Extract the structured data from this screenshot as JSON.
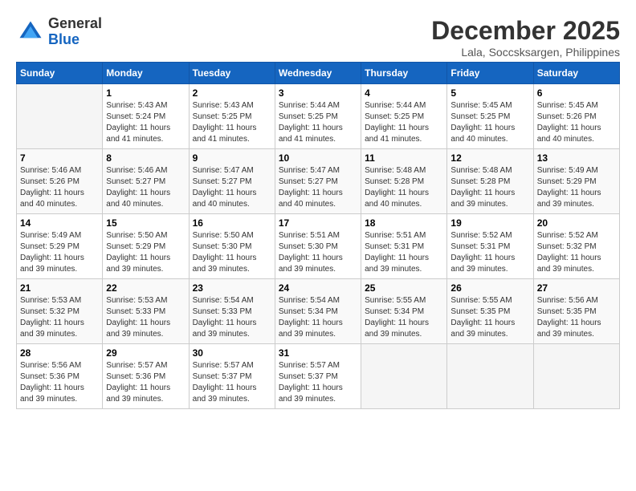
{
  "header": {
    "logo_general": "General",
    "logo_blue": "Blue",
    "month_title": "December 2025",
    "location": "Lala, Soccsksargen, Philippines"
  },
  "days_of_week": [
    "Sunday",
    "Monday",
    "Tuesday",
    "Wednesday",
    "Thursday",
    "Friday",
    "Saturday"
  ],
  "weeks": [
    [
      {
        "day": "",
        "sunrise": "",
        "sunset": "",
        "daylight": ""
      },
      {
        "day": "1",
        "sunrise": "Sunrise: 5:43 AM",
        "sunset": "Sunset: 5:24 PM",
        "daylight": "Daylight: 11 hours and 41 minutes."
      },
      {
        "day": "2",
        "sunrise": "Sunrise: 5:43 AM",
        "sunset": "Sunset: 5:25 PM",
        "daylight": "Daylight: 11 hours and 41 minutes."
      },
      {
        "day": "3",
        "sunrise": "Sunrise: 5:44 AM",
        "sunset": "Sunset: 5:25 PM",
        "daylight": "Daylight: 11 hours and 41 minutes."
      },
      {
        "day": "4",
        "sunrise": "Sunrise: 5:44 AM",
        "sunset": "Sunset: 5:25 PM",
        "daylight": "Daylight: 11 hours and 41 minutes."
      },
      {
        "day": "5",
        "sunrise": "Sunrise: 5:45 AM",
        "sunset": "Sunset: 5:25 PM",
        "daylight": "Daylight: 11 hours and 40 minutes."
      },
      {
        "day": "6",
        "sunrise": "Sunrise: 5:45 AM",
        "sunset": "Sunset: 5:26 PM",
        "daylight": "Daylight: 11 hours and 40 minutes."
      }
    ],
    [
      {
        "day": "7",
        "sunrise": "Sunrise: 5:46 AM",
        "sunset": "Sunset: 5:26 PM",
        "daylight": "Daylight: 11 hours and 40 minutes."
      },
      {
        "day": "8",
        "sunrise": "Sunrise: 5:46 AM",
        "sunset": "Sunset: 5:27 PM",
        "daylight": "Daylight: 11 hours and 40 minutes."
      },
      {
        "day": "9",
        "sunrise": "Sunrise: 5:47 AM",
        "sunset": "Sunset: 5:27 PM",
        "daylight": "Daylight: 11 hours and 40 minutes."
      },
      {
        "day": "10",
        "sunrise": "Sunrise: 5:47 AM",
        "sunset": "Sunset: 5:27 PM",
        "daylight": "Daylight: 11 hours and 40 minutes."
      },
      {
        "day": "11",
        "sunrise": "Sunrise: 5:48 AM",
        "sunset": "Sunset: 5:28 PM",
        "daylight": "Daylight: 11 hours and 40 minutes."
      },
      {
        "day": "12",
        "sunrise": "Sunrise: 5:48 AM",
        "sunset": "Sunset: 5:28 PM",
        "daylight": "Daylight: 11 hours and 39 minutes."
      },
      {
        "day": "13",
        "sunrise": "Sunrise: 5:49 AM",
        "sunset": "Sunset: 5:29 PM",
        "daylight": "Daylight: 11 hours and 39 minutes."
      }
    ],
    [
      {
        "day": "14",
        "sunrise": "Sunrise: 5:49 AM",
        "sunset": "Sunset: 5:29 PM",
        "daylight": "Daylight: 11 hours and 39 minutes."
      },
      {
        "day": "15",
        "sunrise": "Sunrise: 5:50 AM",
        "sunset": "Sunset: 5:29 PM",
        "daylight": "Daylight: 11 hours and 39 minutes."
      },
      {
        "day": "16",
        "sunrise": "Sunrise: 5:50 AM",
        "sunset": "Sunset: 5:30 PM",
        "daylight": "Daylight: 11 hours and 39 minutes."
      },
      {
        "day": "17",
        "sunrise": "Sunrise: 5:51 AM",
        "sunset": "Sunset: 5:30 PM",
        "daylight": "Daylight: 11 hours and 39 minutes."
      },
      {
        "day": "18",
        "sunrise": "Sunrise: 5:51 AM",
        "sunset": "Sunset: 5:31 PM",
        "daylight": "Daylight: 11 hours and 39 minutes."
      },
      {
        "day": "19",
        "sunrise": "Sunrise: 5:52 AM",
        "sunset": "Sunset: 5:31 PM",
        "daylight": "Daylight: 11 hours and 39 minutes."
      },
      {
        "day": "20",
        "sunrise": "Sunrise: 5:52 AM",
        "sunset": "Sunset: 5:32 PM",
        "daylight": "Daylight: 11 hours and 39 minutes."
      }
    ],
    [
      {
        "day": "21",
        "sunrise": "Sunrise: 5:53 AM",
        "sunset": "Sunset: 5:32 PM",
        "daylight": "Daylight: 11 hours and 39 minutes."
      },
      {
        "day": "22",
        "sunrise": "Sunrise: 5:53 AM",
        "sunset": "Sunset: 5:33 PM",
        "daylight": "Daylight: 11 hours and 39 minutes."
      },
      {
        "day": "23",
        "sunrise": "Sunrise: 5:54 AM",
        "sunset": "Sunset: 5:33 PM",
        "daylight": "Daylight: 11 hours and 39 minutes."
      },
      {
        "day": "24",
        "sunrise": "Sunrise: 5:54 AM",
        "sunset": "Sunset: 5:34 PM",
        "daylight": "Daylight: 11 hours and 39 minutes."
      },
      {
        "day": "25",
        "sunrise": "Sunrise: 5:55 AM",
        "sunset": "Sunset: 5:34 PM",
        "daylight": "Daylight: 11 hours and 39 minutes."
      },
      {
        "day": "26",
        "sunrise": "Sunrise: 5:55 AM",
        "sunset": "Sunset: 5:35 PM",
        "daylight": "Daylight: 11 hours and 39 minutes."
      },
      {
        "day": "27",
        "sunrise": "Sunrise: 5:56 AM",
        "sunset": "Sunset: 5:35 PM",
        "daylight": "Daylight: 11 hours and 39 minutes."
      }
    ],
    [
      {
        "day": "28",
        "sunrise": "Sunrise: 5:56 AM",
        "sunset": "Sunset: 5:36 PM",
        "daylight": "Daylight: 11 hours and 39 minutes."
      },
      {
        "day": "29",
        "sunrise": "Sunrise: 5:57 AM",
        "sunset": "Sunset: 5:36 PM",
        "daylight": "Daylight: 11 hours and 39 minutes."
      },
      {
        "day": "30",
        "sunrise": "Sunrise: 5:57 AM",
        "sunset": "Sunset: 5:37 PM",
        "daylight": "Daylight: 11 hours and 39 minutes."
      },
      {
        "day": "31",
        "sunrise": "Sunrise: 5:57 AM",
        "sunset": "Sunset: 5:37 PM",
        "daylight": "Daylight: 11 hours and 39 minutes."
      },
      {
        "day": "",
        "sunrise": "",
        "sunset": "",
        "daylight": ""
      },
      {
        "day": "",
        "sunrise": "",
        "sunset": "",
        "daylight": ""
      },
      {
        "day": "",
        "sunrise": "",
        "sunset": "",
        "daylight": ""
      }
    ]
  ]
}
